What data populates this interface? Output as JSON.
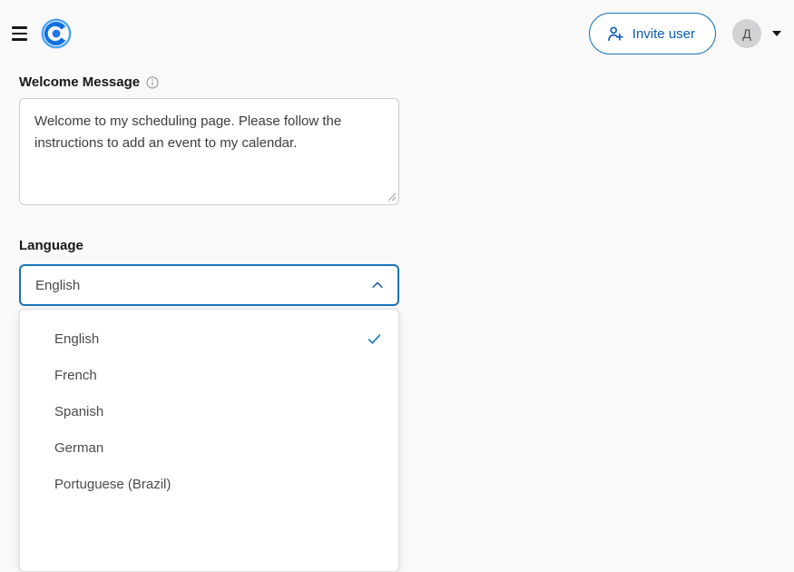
{
  "colors": {
    "page_background": "#f9f9fa",
    "brand_blue": "#0a5bb5",
    "accent_blue": "#1a73b7",
    "logo_blue": "#1e7ae8",
    "text_dark": "#16181a",
    "text_muted": "#4a4a4e",
    "border_gray": "#cdcdd0"
  },
  "header": {
    "menu_icon": "hamburger-menu-icon",
    "logo_icon": "calendly-logo-icon",
    "invite_button": {
      "label": "Invite user",
      "icon": "user-plus-icon"
    },
    "avatar": {
      "initials": "Д"
    },
    "account_caret_icon": "caret-down-icon"
  },
  "welcome_message": {
    "label": "Welcome Message",
    "info_icon": "info-circle-icon",
    "value": "Welcome to my scheduling page. Please follow the instructions to add an event to my calendar.",
    "placeholder": "Welcome to my scheduling page. Please follow the instructions to add an event to my calendar.",
    "resize_handle_icon": "resize-handle-icon"
  },
  "language": {
    "label": "Language",
    "selected": "English",
    "expanded": true,
    "toggle_icon": "chevron-up-icon",
    "check_icon": "check-icon",
    "options": [
      {
        "label": "English",
        "selected": true
      },
      {
        "label": "French",
        "selected": false
      },
      {
        "label": "Spanish",
        "selected": false
      },
      {
        "label": "German",
        "selected": false
      },
      {
        "label": "Portuguese (Brazil)",
        "selected": false
      }
    ]
  }
}
